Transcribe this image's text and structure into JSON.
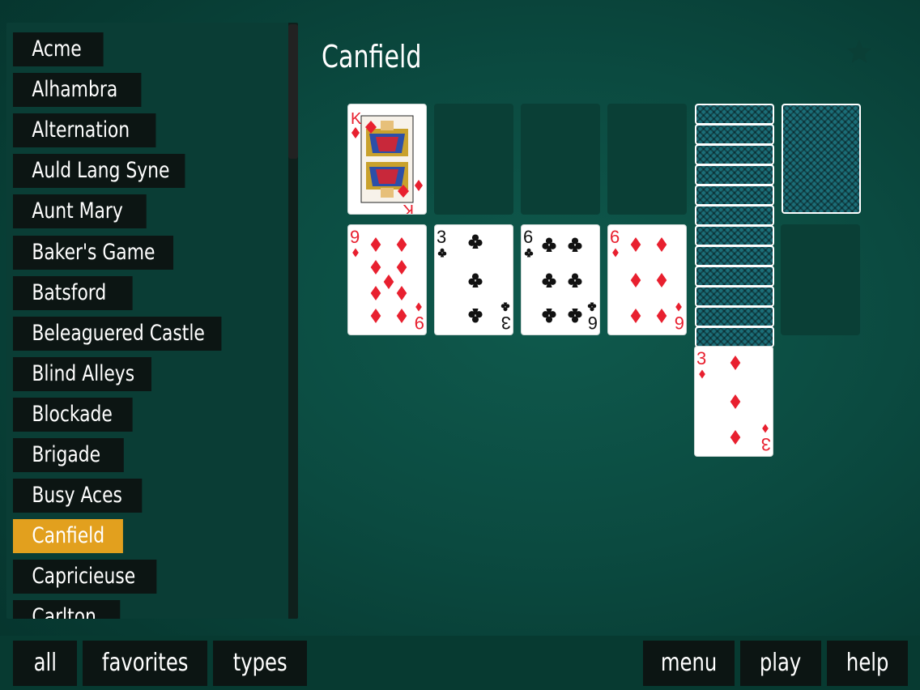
{
  "title": "Canfield",
  "sidebar": {
    "selected_index": 12,
    "games": [
      "Acme",
      "Alhambra",
      "Alternation",
      "Auld Lang Syne",
      "Aunt Mary",
      "Baker's Game",
      "Batsford",
      "Beleaguered Castle",
      "Blind Alleys",
      "Blockade",
      "Brigade",
      "Busy Aces",
      "Canfield",
      "Capricieuse",
      "Carlton"
    ]
  },
  "toolbar": {
    "all_label": "all",
    "favorites_label": "favorites",
    "types_label": "types",
    "menu_label": "menu",
    "play_label": "play",
    "help_label": "help"
  },
  "tableau": {
    "foundation_card": {
      "rank": "K",
      "suit": "diamonds"
    },
    "piles": [
      {
        "rank": "9",
        "suit": "diamonds"
      },
      {
        "rank": "3",
        "suit": "clubs"
      },
      {
        "rank": "6",
        "suit": "clubs"
      },
      {
        "rank": "6",
        "suit": "diamonds"
      }
    ],
    "reserve_top": {
      "rank": "3",
      "suit": "diamonds"
    },
    "reserve_hidden_count": 12
  },
  "colors": {
    "felt": "#0b4a40",
    "selected": "#e2a01e",
    "red_suit": "#e8202f",
    "black_suit": "#111111"
  }
}
